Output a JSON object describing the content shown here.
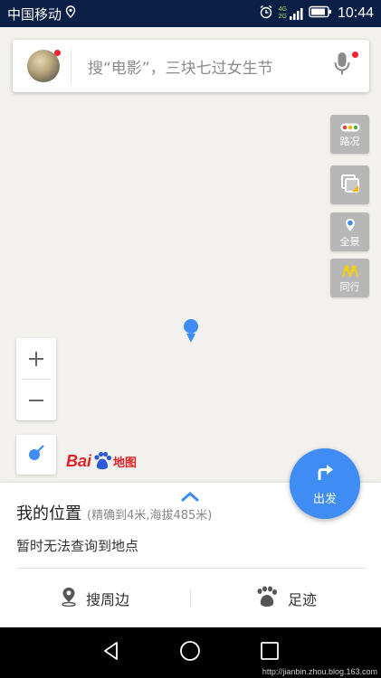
{
  "status_bar": {
    "carrier": "中国移动",
    "network_labels": [
      "4G",
      "2G"
    ],
    "time": "10:44"
  },
  "search": {
    "placeholder": "搜“电影”，三块七过女生节"
  },
  "map_tools": [
    {
      "name": "traffic",
      "label": "路况",
      "icon": "traffic-icon"
    },
    {
      "name": "layers",
      "label": "",
      "icon": "layers-icon"
    },
    {
      "name": "panorama",
      "label": "全景",
      "icon": "panorama-icon"
    },
    {
      "name": "companion",
      "label": "同行",
      "icon": "companion-icon"
    }
  ],
  "zoom": {
    "in": "+",
    "out": "−"
  },
  "logo": {
    "bai": "Bai",
    "map": "地图"
  },
  "fab": {
    "label": "出发"
  },
  "panel": {
    "title": "我的位置",
    "accuracy": "(精确到4米,海拔485米)",
    "status": "暂时无法查询到地点",
    "actions": [
      {
        "label": "搜周边",
        "icon": "location-pin-icon"
      },
      {
        "label": "足迹",
        "icon": "footprint-icon"
      }
    ]
  },
  "watermark": "http://jianbin.zhou.blog.163.com",
  "colors": {
    "status_bar_bg": "#0c1f47",
    "accent_blue": "#3e8cf4",
    "notification_red": "#f5232d",
    "tool_gray": "#b7b7b7"
  }
}
